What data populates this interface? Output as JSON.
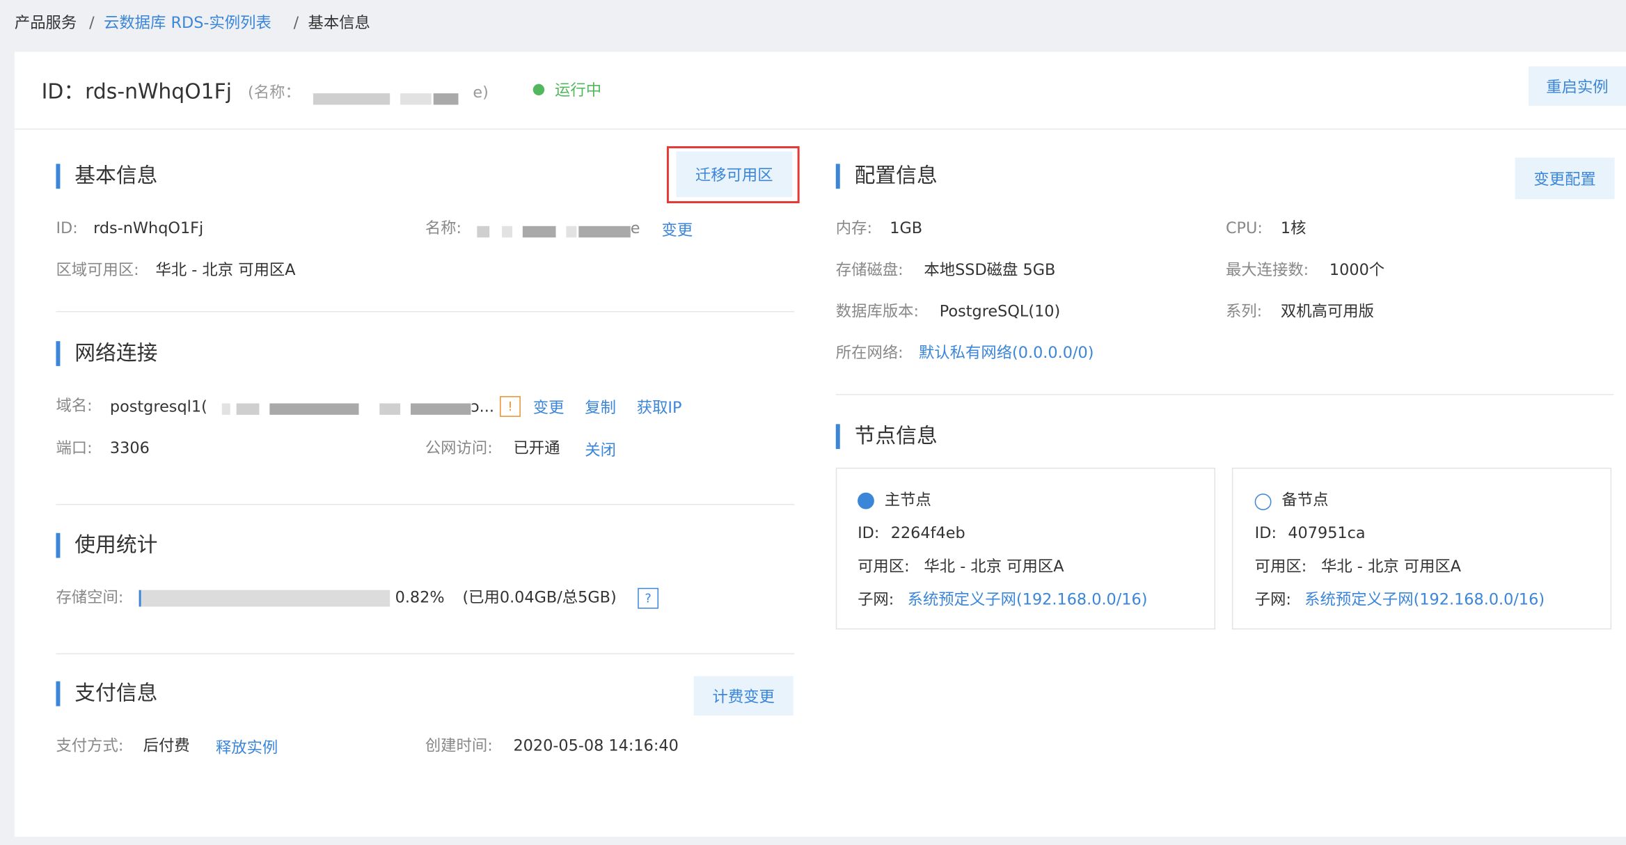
{
  "breadcrumb": {
    "item1": "产品服务",
    "sep": "/",
    "item2": "云数据库 RDS-实例列表",
    "item3": "基本信息"
  },
  "header": {
    "id_label": "ID：",
    "id_value": "rds-nWhqO1Fj",
    "name_prefix": "(名称：",
    "name_suffix": "e)",
    "status": "运行中",
    "status_color": "#52b85d",
    "restart_button": "重启实例"
  },
  "basic": {
    "title": "基本信息",
    "migrate_button": "迁移可用区",
    "id_label": "ID:",
    "id_value": "rds-nWhqO1Fj",
    "name_label": "名称:",
    "name_tail": "e",
    "change_link": "变更",
    "zone_label": "区域可用区:",
    "zone_value": "华北 - 北京 可用区A"
  },
  "network": {
    "title": "网络连接",
    "domain_label": "域名:",
    "domain_value": "postgresql1(",
    "domain_tail": "ɔ...",
    "warning_icon": "!",
    "change_link": "变更",
    "copy_link": "复制",
    "get_ip_link": "获取IP",
    "port_label": "端口:",
    "port_value": "3306",
    "public_label": "公网访问:",
    "public_value": "已开通",
    "close_link": "关闭"
  },
  "usage": {
    "title": "使用统计",
    "storage_label": "存储空间:",
    "percent": "0.82%",
    "used_fraction": 0.0082,
    "detail": "(已用0.04GB/总5GB)",
    "help_icon": "?"
  },
  "payment": {
    "title": "支付信息",
    "billing_button": "计费变更",
    "method_label": "支付方式:",
    "method_value": "后付费",
    "release_link": "释放实例",
    "created_label": "创建时间:",
    "created_value": "2020-05-08 14:16:40"
  },
  "config": {
    "title": "配置信息",
    "change_button": "变更配置",
    "memory_label": "内存:",
    "memory_value": "1GB",
    "cpu_label": "CPU:",
    "cpu_value": "1核",
    "disk_label": "存储磁盘:",
    "disk_value": "本地SSD磁盘 5GB",
    "maxconn_label": "最大连接数:",
    "maxconn_value": "1000个",
    "version_label": "数据库版本:",
    "version_value": "PostgreSQL(10)",
    "series_label": "系列:",
    "series_value": "双机高可用版",
    "network_label": "所在网络:",
    "network_value": "默认私有网络(0.0.0.0/0)"
  },
  "nodes": {
    "title": "节点信息",
    "primary": {
      "label": "主节点",
      "id_label": "ID:",
      "id_value": "2264f4eb",
      "zone_label": "可用区:",
      "zone_value": "华北 - 北京 可用区A",
      "subnet_label": "子网:",
      "subnet_value": "系统预定义子网(192.168.0.0/16)"
    },
    "standby": {
      "label": "备节点",
      "id_label": "ID:",
      "id_value": "407951ca",
      "zone_label": "可用区:",
      "zone_value": "华北 - 北京 可用区A",
      "subnet_label": "子网:",
      "subnet_value": "系统预定义子网(192.168.0.0/16)"
    }
  },
  "colors": {
    "accent": "#3b86d8",
    "highlight_box": "#e53935",
    "warning": "#e8912d"
  }
}
